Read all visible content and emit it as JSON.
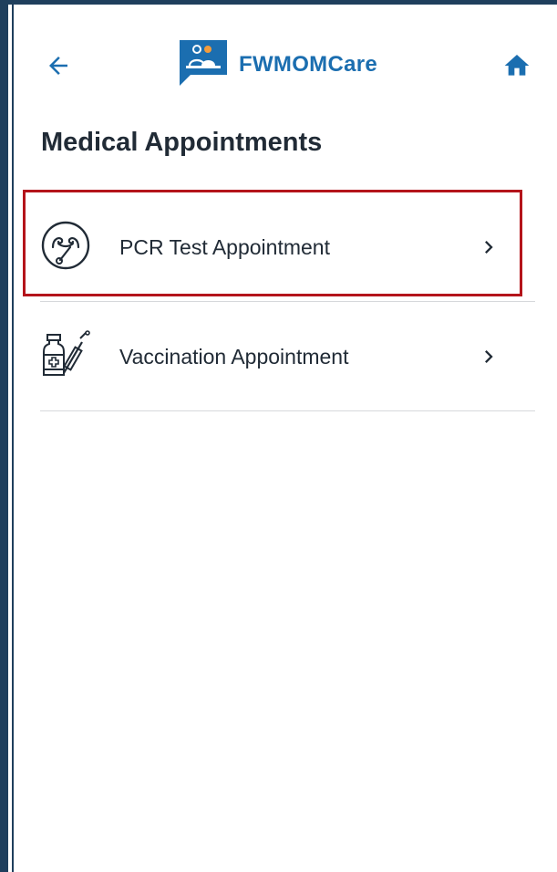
{
  "header": {
    "brand": "FWMOMCare"
  },
  "page": {
    "title": "Medical Appointments"
  },
  "items": [
    {
      "label": "PCR Test Appointment",
      "icon": "nose-swab-icon"
    },
    {
      "label": "Vaccination Appointment",
      "icon": "vaccine-syringe-icon"
    }
  ],
  "colors": {
    "brand": "#1b6eb0",
    "frame": "#1f3f5d",
    "highlight": "#b4141b",
    "text": "#212b36",
    "divider": "#d6d8db"
  }
}
